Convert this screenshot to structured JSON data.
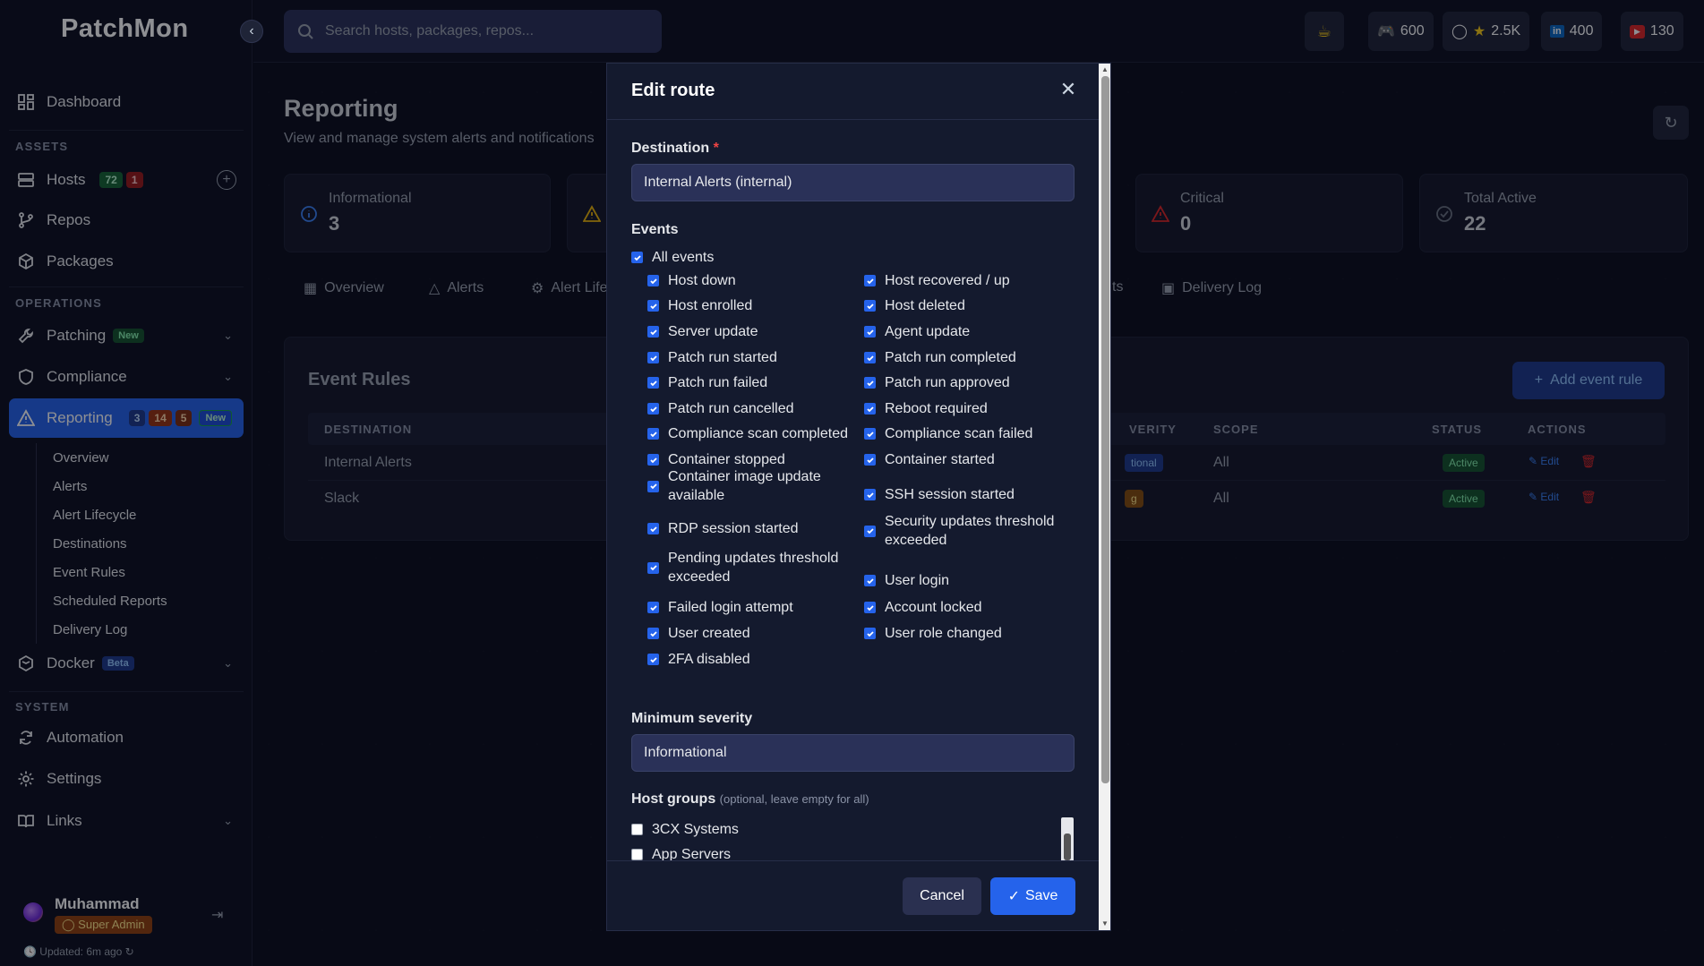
{
  "app": {
    "logo": "PatchMon"
  },
  "sidebar": {
    "dashboard": "Dashboard",
    "assets_label": "ASSETS",
    "hosts": {
      "label": "Hosts",
      "count_a": "72",
      "count_b": "1"
    },
    "repos": "Repos",
    "packages": "Packages",
    "operations_label": "OPERATIONS",
    "patching": {
      "label": "Patching",
      "badge": "New"
    },
    "compliance": "Compliance",
    "reporting": {
      "label": "Reporting",
      "c1": "3",
      "c2": "14",
      "c3": "5",
      "badge": "New"
    },
    "reporting_sub": [
      "Overview",
      "Alerts",
      "Alert Lifecycle",
      "Destinations",
      "Event Rules",
      "Scheduled Reports",
      "Delivery Log"
    ],
    "docker": {
      "label": "Docker",
      "badge": "Beta"
    },
    "system_label": "SYSTEM",
    "automation": "Automation",
    "settings": "Settings",
    "links": "Links",
    "user": {
      "name": "Muhammad",
      "role": "Super Admin",
      "updated": "Updated: 6m ago"
    }
  },
  "topbar": {
    "search_placeholder": "Search hosts, packages, repos...",
    "discord": "600",
    "github": "2.5K",
    "linkedin": "400",
    "youtube": "130"
  },
  "page": {
    "title": "Reporting",
    "subtitle": "View and manage system alerts and notifications",
    "stats": [
      {
        "label": "Informational",
        "value": "3"
      },
      {
        "label": "Critical",
        "value": "0"
      },
      {
        "label": "Total Active",
        "value": "22"
      }
    ],
    "tabs": [
      "Overview",
      "Alerts",
      "Alert Life",
      "ts",
      "Delivery Log"
    ],
    "panel_title": "Event Rules",
    "add_rule": "Add event rule",
    "columns": [
      "DESTINATION",
      "VERITY",
      "SCOPE",
      "STATUS",
      "ACTIONS"
    ],
    "rows": [
      {
        "destination": "Internal Alerts",
        "severity": "tional",
        "scope": "All",
        "status": "Active",
        "edit": "Edit"
      },
      {
        "destination": "Slack",
        "severity": "g",
        "scope": "All",
        "status": "Active",
        "edit": "Edit"
      }
    ]
  },
  "modal": {
    "title": "Edit route",
    "destination_label": "Destination",
    "required_mark": "*",
    "destination_value": "Internal Alerts (internal)",
    "events_label": "Events",
    "all_events": "All events",
    "events_left": [
      "Host down",
      "Host enrolled",
      "Server update",
      "Patch run started",
      "Patch run failed",
      "Patch run cancelled",
      "Compliance scan completed",
      "Container stopped",
      "Container image update available",
      "RDP session started",
      "Pending updates threshold exceeded",
      "Failed login attempt",
      "User created",
      "2FA disabled"
    ],
    "events_right": [
      "Host recovered / up",
      "Host deleted",
      "Agent update",
      "Patch run completed",
      "Patch run approved",
      "Reboot required",
      "Compliance scan failed",
      "Container started",
      "SSH session started",
      "Security updates threshold exceeded",
      "User login",
      "Account locked",
      "User role changed"
    ],
    "severity_label": "Minimum severity",
    "severity_value": "Informational",
    "host_groups_label": "Host groups",
    "host_groups_hint": "(optional, leave empty for all)",
    "host_groups": [
      "3CX Systems",
      "App Servers"
    ],
    "cancel": "Cancel",
    "save": "Save"
  }
}
